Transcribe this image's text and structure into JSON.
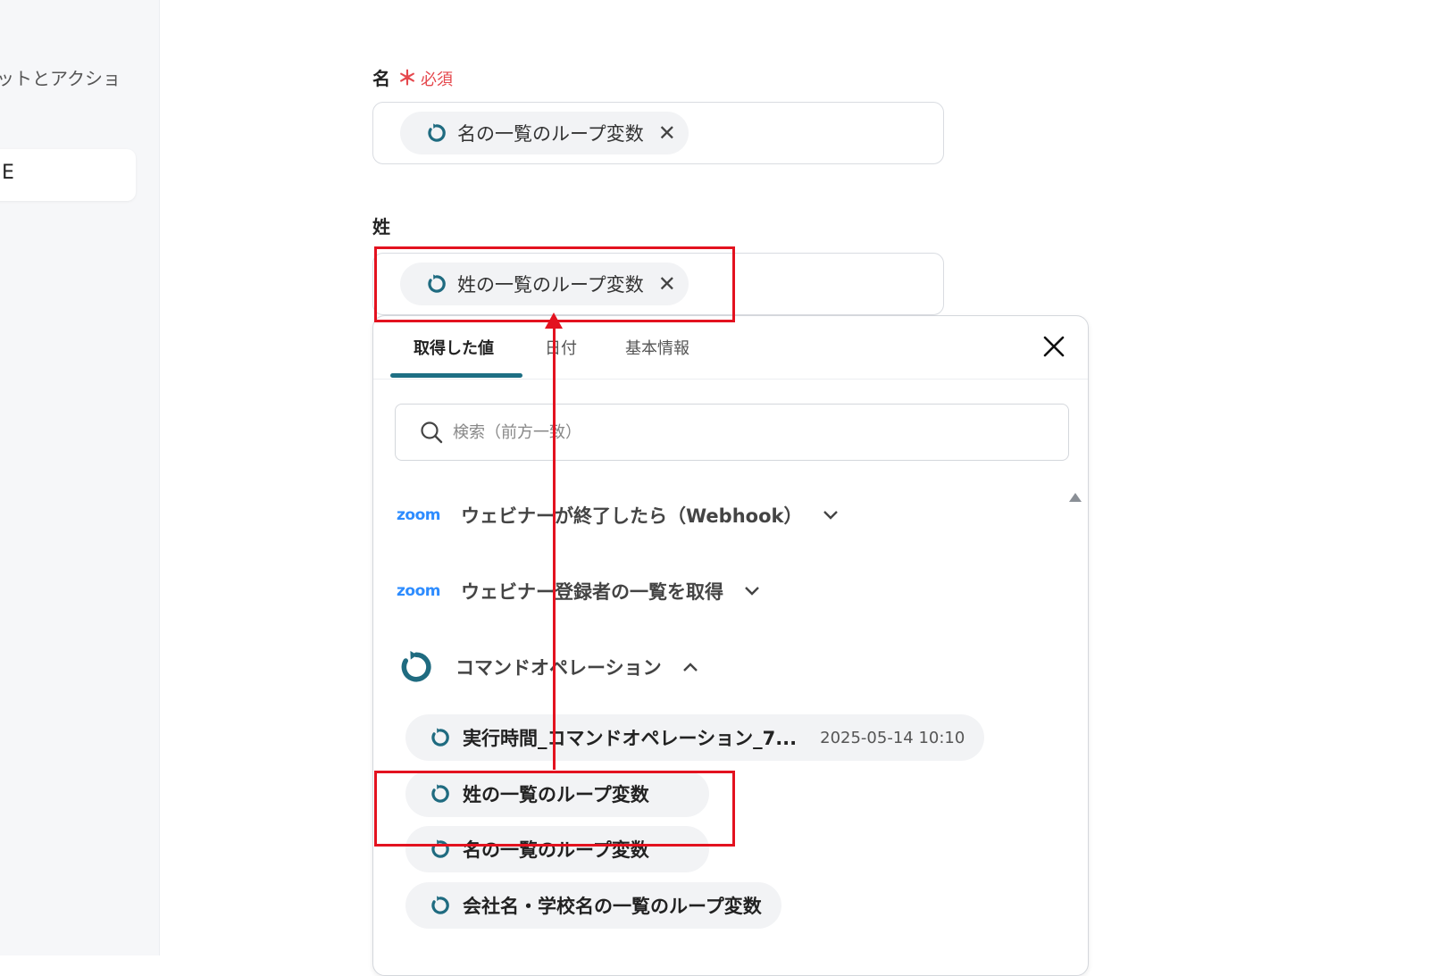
{
  "sidebar": {
    "partial_text": "ットとアクショ",
    "card_text": "E"
  },
  "first_name": {
    "label": "名",
    "required_mark": "＊",
    "required_text": "必須",
    "chip_label": "名の一覧のループ変数"
  },
  "last_name": {
    "label": "姓",
    "chip_label": "姓の一覧のループ変数"
  },
  "popup": {
    "tabs": [
      "取得した値",
      "日付",
      "基本情報"
    ],
    "active_tab": "取得した値",
    "search_placeholder": "検索（前方一致）",
    "groups": [
      {
        "logo": "zoom",
        "label": "ウェビナーが終了したら（Webhook）",
        "expanded": false
      },
      {
        "logo": "zoom",
        "label": "ウェビナー登録者の一覧を取得",
        "expanded": false
      },
      {
        "logo": "command-operation-icon",
        "label": "コマンドオペレーション",
        "expanded": true
      }
    ],
    "items": [
      {
        "label": "実行時間_コマンドオペレーション_7...",
        "timestamp": "2025-05-14 10:10"
      },
      {
        "label": "姓の一覧のループ変数"
      },
      {
        "label": "名の一覧のループ変数"
      },
      {
        "label": "会社名・学校名の一覧のループ変数"
      }
    ]
  },
  "colors": {
    "accent": "#1e6f84",
    "highlight": "#e3121f",
    "required": "#e5484d",
    "zoom_blue": "#2d8cff"
  }
}
